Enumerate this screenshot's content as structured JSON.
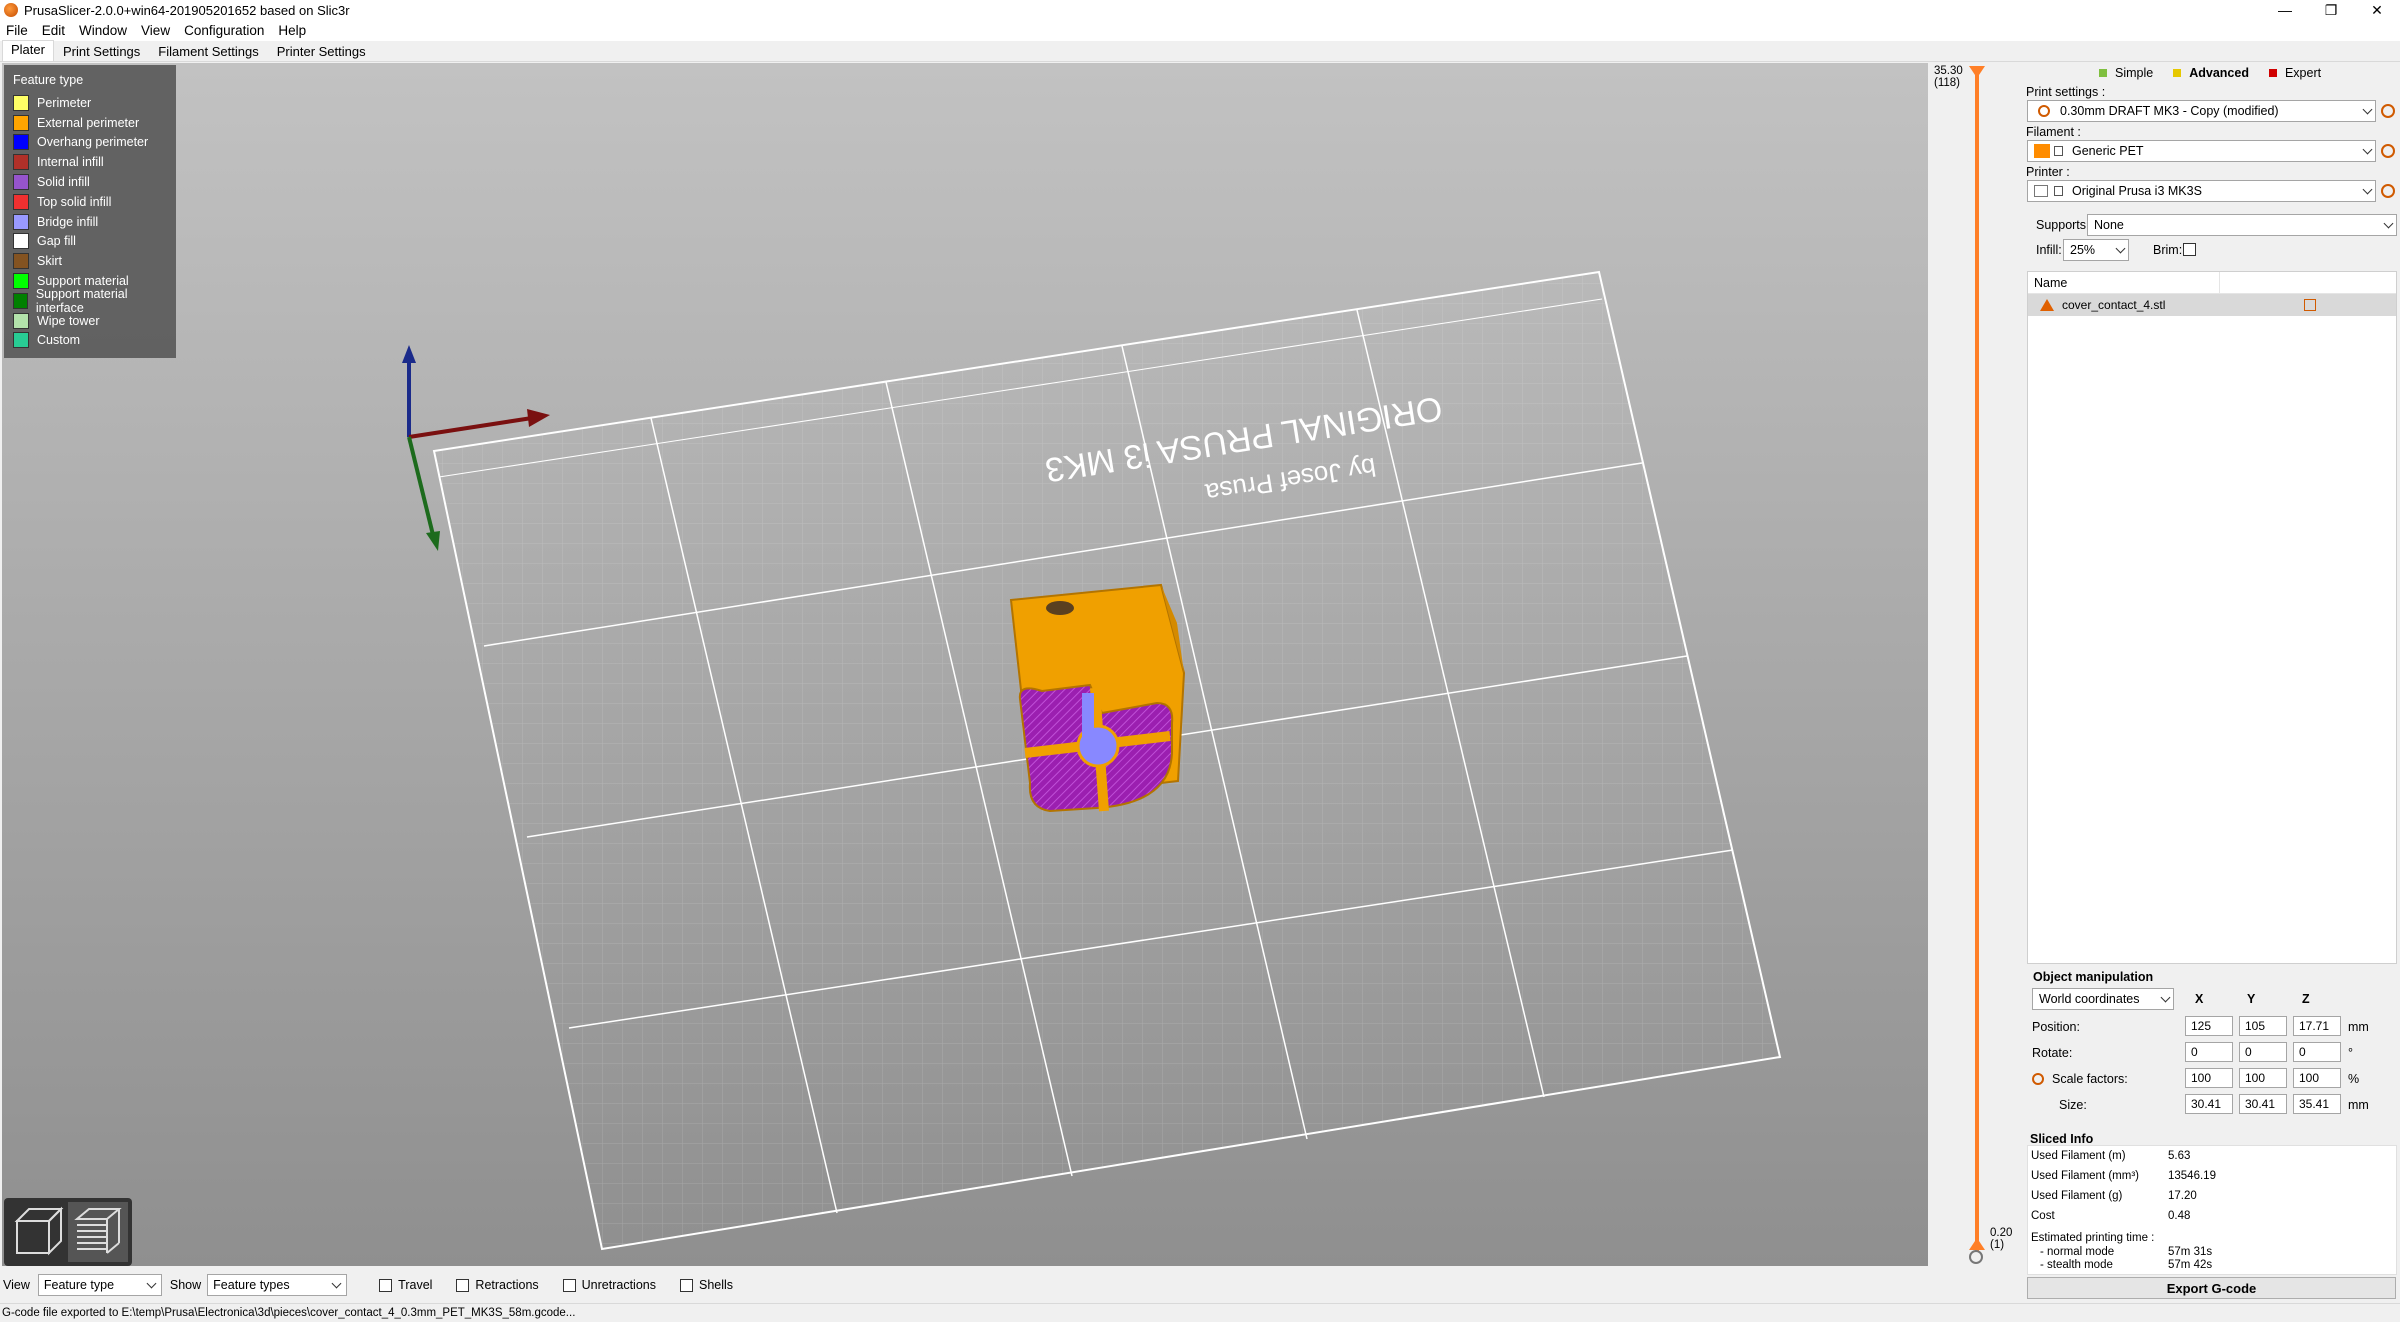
{
  "window": {
    "title": "PrusaSlicer-2.0.0+win64-201905201652 based on Slic3r",
    "controls": [
      "—",
      "❐",
      "✕"
    ]
  },
  "menu": [
    "File",
    "Edit",
    "Window",
    "View",
    "Configuration",
    "Help"
  ],
  "tabs": [
    "Plater",
    "Print Settings",
    "Filament Settings",
    "Printer Settings"
  ],
  "legend": {
    "title": "Feature type",
    "items": [
      {
        "label": "Perimeter",
        "color": "#ffff66"
      },
      {
        "label": "External perimeter",
        "color": "#ffa500"
      },
      {
        "label": "Overhang perimeter",
        "color": "#0000ff"
      },
      {
        "label": "Internal infill",
        "color": "#b03029"
      },
      {
        "label": "Solid infill",
        "color": "#9654cc"
      },
      {
        "label": "Top solid infill",
        "color": "#f03030"
      },
      {
        "label": "Bridge infill",
        "color": "#9999ff"
      },
      {
        "label": "Gap fill",
        "color": "#ffffff"
      },
      {
        "label": "Skirt",
        "color": "#845321"
      },
      {
        "label": "Support material",
        "color": "#00ff00"
      },
      {
        "label": "Support material interface",
        "color": "#008000"
      },
      {
        "label": "Wipe tower",
        "color": "#b3e3ab"
      },
      {
        "label": "Custom",
        "color": "#28cc94"
      }
    ]
  },
  "bed": {
    "brand_line1": "ORIGINAL PRUSA i3 MK3",
    "brand_line2": "by Josef Prusa"
  },
  "layer_slider": {
    "top_value": "35.30",
    "top_layer": "(118)",
    "bottom_value": "0.20",
    "bottom_layer": "(1)"
  },
  "modes": [
    {
      "label": "Simple",
      "color": "#7fbf3f"
    },
    {
      "label": "Advanced",
      "color": "#e6c800"
    },
    {
      "label": "Expert",
      "color": "#d00000"
    }
  ],
  "print_settings": {
    "label": "Print settings :",
    "value": "0.30mm DRAFT MK3 - Copy (modified)"
  },
  "filament": {
    "label": "Filament :",
    "value": "Generic PET",
    "swatch_color": "#ff8c00"
  },
  "printer": {
    "label": "Printer :",
    "value": "Original Prusa i3 MK3S"
  },
  "supports": {
    "label": "Supports:",
    "value": "None"
  },
  "infill": {
    "label": "Infill:",
    "value": "25%"
  },
  "brim": {
    "label": "Brim:"
  },
  "object_list": {
    "header": "Name",
    "rows": [
      {
        "name": "cover_contact_4.stl"
      }
    ]
  },
  "object_manipulation": {
    "title": "Object manipulation",
    "coord_system": "World coordinates",
    "axes": [
      "X",
      "Y",
      "Z"
    ],
    "rows": [
      {
        "label": "Position:",
        "values": [
          "125",
          "105",
          "17.71"
        ],
        "unit": "mm"
      },
      {
        "label": "Rotate:",
        "values": [
          "0",
          "0",
          "0"
        ],
        "unit": "°"
      },
      {
        "label": "Scale factors:",
        "values": [
          "100",
          "100",
          "100"
        ],
        "unit": "%"
      },
      {
        "label": "Size:",
        "values": [
          "30.41",
          "30.41",
          "35.41"
        ],
        "unit": "mm"
      }
    ]
  },
  "sliced_info": {
    "title": "Sliced Info",
    "rows": [
      {
        "label": "Used Filament (m)",
        "value": "5.63"
      },
      {
        "label": "Used Filament (mm³)",
        "value": "13546.19"
      },
      {
        "label": "Used Filament (g)",
        "value": "17.20"
      },
      {
        "label": "Cost",
        "value": "0.48"
      }
    ],
    "time_label": "Estimated printing time :",
    "normal_label": "- normal mode",
    "normal_value": "57m 31s",
    "stealth_label": "- stealth mode",
    "stealth_value": "57m 42s"
  },
  "export_button": "Export G-code",
  "bottom_bar": {
    "view_label": "View",
    "view_value": "Feature type",
    "show_label": "Show",
    "show_value": "Feature types",
    "checkboxes": [
      "Travel",
      "Retractions",
      "Unretractions",
      "Shells"
    ]
  },
  "status": "G-code file exported to E:\\temp\\Prusa\\Electronica\\3d\\pieces\\cover_contact_4_0.3mm_PET_MK3S_58m.gcode..."
}
